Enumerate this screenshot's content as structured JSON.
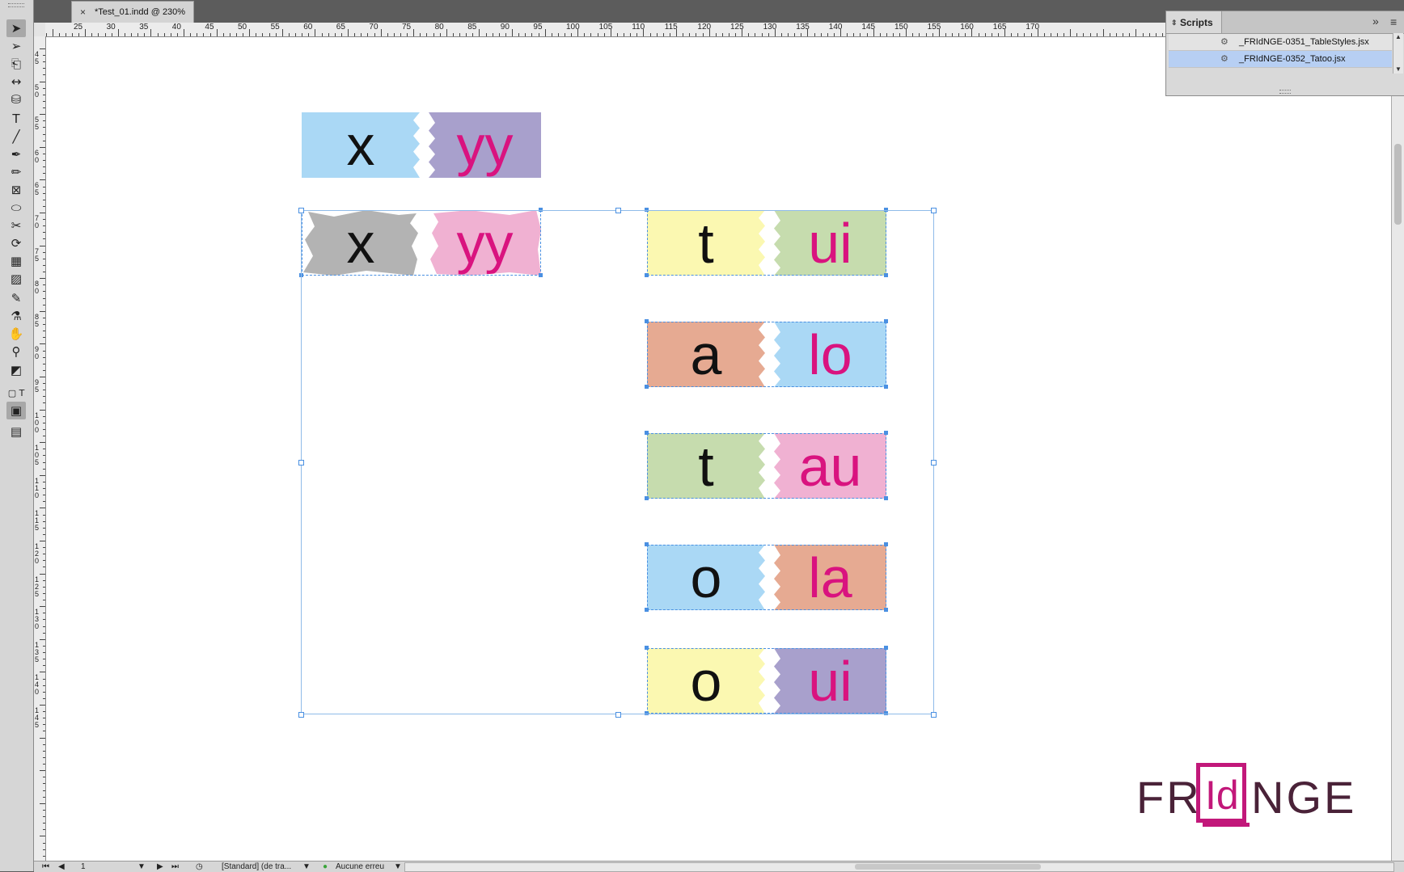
{
  "document_tab": {
    "close": "×",
    "title": "*Test_01.indd @ 230%"
  },
  "ruler": {
    "h_labels": [
      "25",
      "30",
      "35",
      "40",
      "45",
      "50",
      "55",
      "60",
      "65",
      "70",
      "75",
      "80",
      "85",
      "90",
      "95",
      "100",
      "105",
      "110",
      "115",
      "120",
      "125",
      "130",
      "135",
      "140",
      "145",
      "150",
      "155",
      "160",
      "165",
      "170"
    ],
    "v_labels": [
      "4\n5",
      "5\n0",
      "5\n5",
      "6\n0",
      "6\n5",
      "7\n0",
      "7\n5",
      "8\n0",
      "8\n5",
      "9\n0",
      "9\n5",
      "1\n0\n0",
      "1\n0\n5",
      "1\n1\n0",
      "1\n1\n5",
      "1\n2\n0",
      "1\n2\n5",
      "1\n3\n0",
      "1\n3\n5",
      "1\n4\n0",
      "1\n4\n5"
    ]
  },
  "tools": [
    {
      "name": "selection-tool",
      "glyph": "➤"
    },
    {
      "name": "direct-selection-tool",
      "glyph": "➢"
    },
    {
      "name": "page-tool",
      "glyph": "⎗"
    },
    {
      "name": "gap-tool",
      "glyph": "↔"
    },
    {
      "name": "content-collector-tool",
      "glyph": "⛁"
    },
    {
      "name": "type-tool",
      "glyph": "T"
    },
    {
      "name": "line-tool",
      "glyph": "╱"
    },
    {
      "name": "pen-tool",
      "glyph": "✒"
    },
    {
      "name": "pencil-tool",
      "glyph": "✏"
    },
    {
      "name": "rectangle-frame-tool",
      "glyph": "⊠"
    },
    {
      "name": "ellipse-tool",
      "glyph": "⬭"
    },
    {
      "name": "scissors-tool",
      "glyph": "✂"
    },
    {
      "name": "free-transform-tool",
      "glyph": "⟳"
    },
    {
      "name": "gradient-swatch-tool",
      "glyph": "▦"
    },
    {
      "name": "gradient-feather-tool",
      "glyph": "▨"
    },
    {
      "name": "note-tool",
      "glyph": "✎"
    },
    {
      "name": "eyedropper-tool",
      "glyph": "⚗"
    },
    {
      "name": "hand-tool",
      "glyph": "✋"
    },
    {
      "name": "zoom-tool",
      "glyph": "⚲"
    },
    {
      "name": "fill-stroke-swatch",
      "glyph": "◩"
    },
    {
      "name": "formatting-container-toggle",
      "glyph": "▢ T"
    },
    {
      "name": "normal-view-mode",
      "glyph": "▣"
    },
    {
      "name": "preview-view-mode",
      "glyph": "▤"
    }
  ],
  "scripts_panel": {
    "title": "Scripts",
    "expand_glyph": "»",
    "menu_glyph": "≡",
    "items": [
      {
        "label": "_FRIdNGE-0351_TableStyles.jsx",
        "icon": "script-icon",
        "selected": false
      },
      {
        "label": "_FRIdNGE-0352_Tatoo.jsx",
        "icon": "script-icon",
        "selected": true
      }
    ]
  },
  "labels": [
    {
      "left_text": "x",
      "right_text": "yy",
      "left_color": "#aad8f5",
      "right_color": "#a8a0cc",
      "style": "jagged",
      "selected": false
    },
    {
      "left_text": "x",
      "right_text": "yy",
      "left_color": "#b3b3b3",
      "right_color": "#f0b1d2",
      "style": "torn",
      "selected": true
    },
    {
      "left_text": "t",
      "right_text": "ui",
      "left_color": "#fbf8b1",
      "right_color": "#c6dcae",
      "style": "jagged",
      "selected": true
    },
    {
      "left_text": "a",
      "right_text": "lo",
      "left_color": "#e6aa92",
      "right_color": "#aad8f5",
      "style": "jagged",
      "selected": true
    },
    {
      "left_text": "t",
      "right_text": "au",
      "left_color": "#c6dcae",
      "right_color": "#f0b1d2",
      "style": "jagged",
      "selected": true
    },
    {
      "left_text": "o",
      "right_text": "la",
      "left_color": "#aad8f5",
      "right_color": "#e6aa92",
      "style": "jagged",
      "selected": true
    },
    {
      "left_text": "o",
      "right_text": "ui",
      "left_color": "#fbf8b1",
      "right_color": "#a8a0cc",
      "style": "jagged",
      "selected": true
    }
  ],
  "logo": {
    "left": "FR",
    "box": "Id",
    "right": "NGE",
    "dark_color": "#4a2238",
    "accent_color": "#c2187a"
  },
  "status_bar": {
    "page_number": "1",
    "page_style": "[Standard] (de tra...",
    "preflight": "Aucune erreu"
  }
}
